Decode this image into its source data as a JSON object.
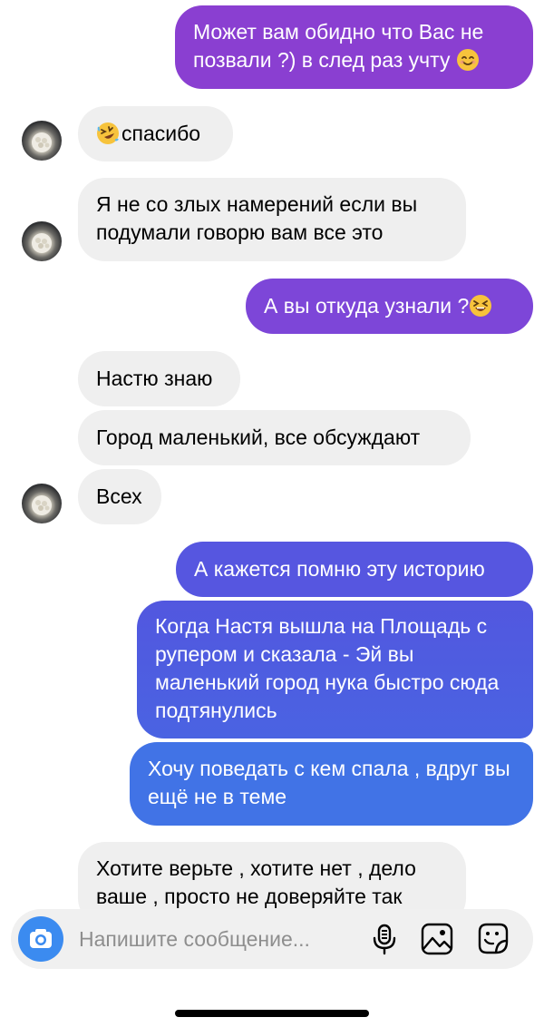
{
  "colors": {
    "incoming_bubble": "#efefef",
    "outgoing_purple": "#8a3fd1",
    "outgoing_indigo": "#5a55df",
    "outgoing_blue": "#3f77e6",
    "camera_button": "#3b8bf0"
  },
  "messages": [
    {
      "from": "me",
      "text": "Может вам обидно что Вас не позвали ?) в след раз учту",
      "emoji": "smiling-face-emoji"
    },
    {
      "from": "them",
      "text": "спасибо",
      "emoji_before": "rolling-on-floor-laughing-emoji"
    },
    {
      "from": "them",
      "text": "Я не со злых намерений если вы подумали говорю вам все это"
    },
    {
      "from": "me",
      "text": "А вы откуда узнали ?",
      "emoji": "squinting-laughing-emoji"
    },
    {
      "from": "them",
      "text": "Настю знаю"
    },
    {
      "from": "them",
      "text": "Город маленький, все обсуждают"
    },
    {
      "from": "them",
      "text": "Всех"
    },
    {
      "from": "me",
      "text": "А кажется помню эту историю"
    },
    {
      "from": "me",
      "text": "Когда Настя вышла на Площадь с рупером и сказала - Эй вы маленький город нука быстро сюда подтянулись"
    },
    {
      "from": "me",
      "text": "Хочу поведать с кем спала , вдруг вы ещё не в теме"
    },
    {
      "from": "them",
      "text": "Хотите верьте , хотите нет , дело ваше , просто не доверяйте так"
    }
  ],
  "composer": {
    "placeholder": "Напишите сообщение...",
    "icons": [
      "camera-icon",
      "microphone-icon",
      "gallery-icon",
      "sticker-icon"
    ]
  }
}
